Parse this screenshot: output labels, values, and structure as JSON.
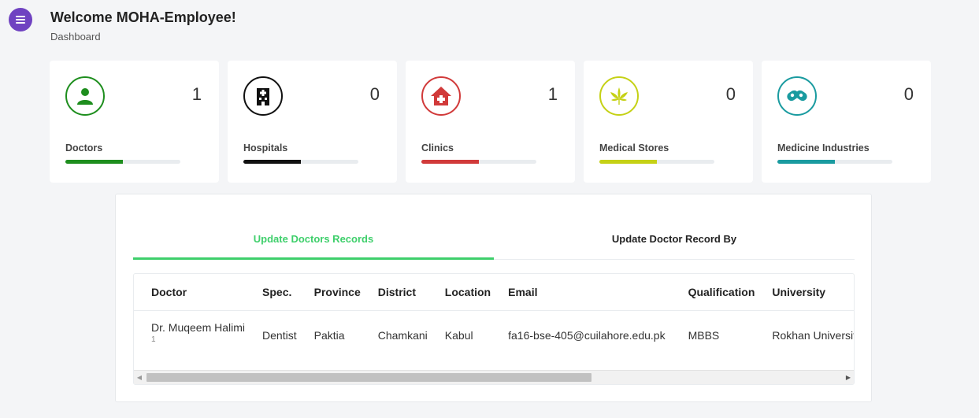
{
  "header": {
    "title": "Welcome MOHA-Employee!",
    "breadcrumb": "Dashboard"
  },
  "menu_icon": "hamburger-menu-icon",
  "cards": [
    {
      "label": "Doctors",
      "count": "1",
      "icon": "user-icon",
      "color": "#1e8e1e",
      "progress": 0.5
    },
    {
      "label": "Hospitals",
      "count": "0",
      "icon": "hospital-building-icon",
      "color": "#111111",
      "progress": 0.5
    },
    {
      "label": "Clinics",
      "count": "1",
      "icon": "clinic-house-medical-icon",
      "color": "#d13a3a",
      "progress": 0.5
    },
    {
      "label": "Medical Stores",
      "count": "0",
      "icon": "cannabis-leaf-icon",
      "color": "#c5d116",
      "progress": 0.5
    },
    {
      "label": "Medicine Industries",
      "count": "0",
      "icon": "capsules-icon",
      "color": "#1a9ba0",
      "progress": 0.5
    }
  ],
  "tabs": [
    {
      "label": "Update Doctors Records",
      "active": true
    },
    {
      "label": "Update Doctor Record By",
      "active": false
    }
  ],
  "table": {
    "columns": [
      "Doctor",
      "Spec.",
      "Province",
      "District",
      "Location",
      "Email",
      "Qualification",
      "University"
    ],
    "rows": [
      {
        "doctor": "Dr. Muqeem Halimi",
        "doctor_sub": "1",
        "spec": "Dentist",
        "province": "Paktia",
        "district": "Chamkani",
        "location": "Kabul",
        "email": "fa16-bse-405@cuilahore.edu.pk",
        "qualification": "MBBS",
        "university": "Rokhan University"
      }
    ]
  },
  "colors": {
    "accent": "#3ecf6b",
    "menu": "#6f42c1"
  }
}
